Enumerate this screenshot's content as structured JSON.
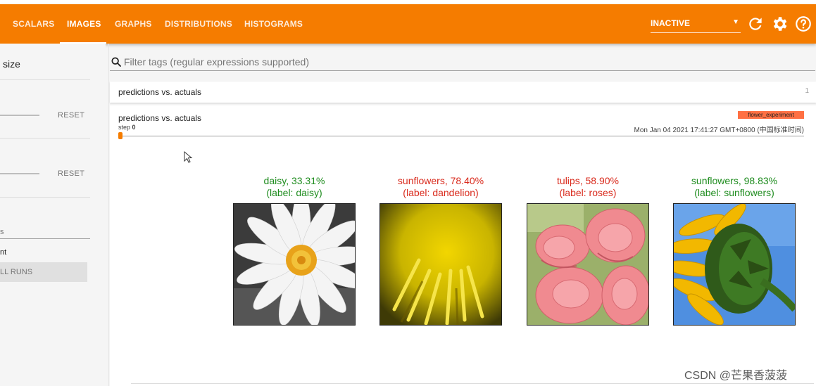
{
  "toolbar": {
    "tabs": [
      {
        "label": "SCALARS"
      },
      {
        "label": "IMAGES"
      },
      {
        "label": "GRAPHS"
      },
      {
        "label": "DISTRIBUTIONS"
      },
      {
        "label": "HISTOGRAMS"
      }
    ],
    "active_tab": "IMAGES",
    "run_selector": {
      "value": "INACTIVE"
    },
    "colors": {
      "bar": "#f57c00"
    },
    "icons": [
      "dropdown-caret-icon",
      "refresh-icon",
      "settings-gear-icon",
      "help-icon"
    ]
  },
  "sidebar": {
    "size_label": "size",
    "reset_1": "RESET",
    "reset_2": "RESET",
    "runs_fragment": "s",
    "run_fragment": "nt",
    "all_runs": "LL RUNS"
  },
  "filter": {
    "placeholder": "Filter tags (regular expressions supported)"
  },
  "group": {
    "title": "predictions vs. actuals",
    "count": "1"
  },
  "card": {
    "title": "predictions vs. actuals",
    "step_label": "step",
    "step_value": "0",
    "run_chip": "flower_experiment",
    "timestamp": "Mon Jan 04 2021 17:41:27 GMT+0800 (中国标准时间)",
    "step_position": 0
  },
  "images": [
    {
      "prediction": "daisy, 33.31%",
      "label": "(label: daisy)",
      "color": "#1e8c1e",
      "subject": "white daisy"
    },
    {
      "prediction": "sunflowers, 78.40%",
      "label": "(label: dandelion)",
      "color": "#d92a1c",
      "subject": "yellow dandelion"
    },
    {
      "prediction": "tulips, 58.90%",
      "label": "(label: roses)",
      "color": "#d92a1c",
      "subject": "pink roses"
    },
    {
      "prediction": "sunflowers, 98.83%",
      "label": "(label: sunflowers)",
      "color": "#1e8c1e",
      "subject": "sunflower on blue sky"
    }
  ],
  "watermark": "CSDN @芒果香菠菠"
}
